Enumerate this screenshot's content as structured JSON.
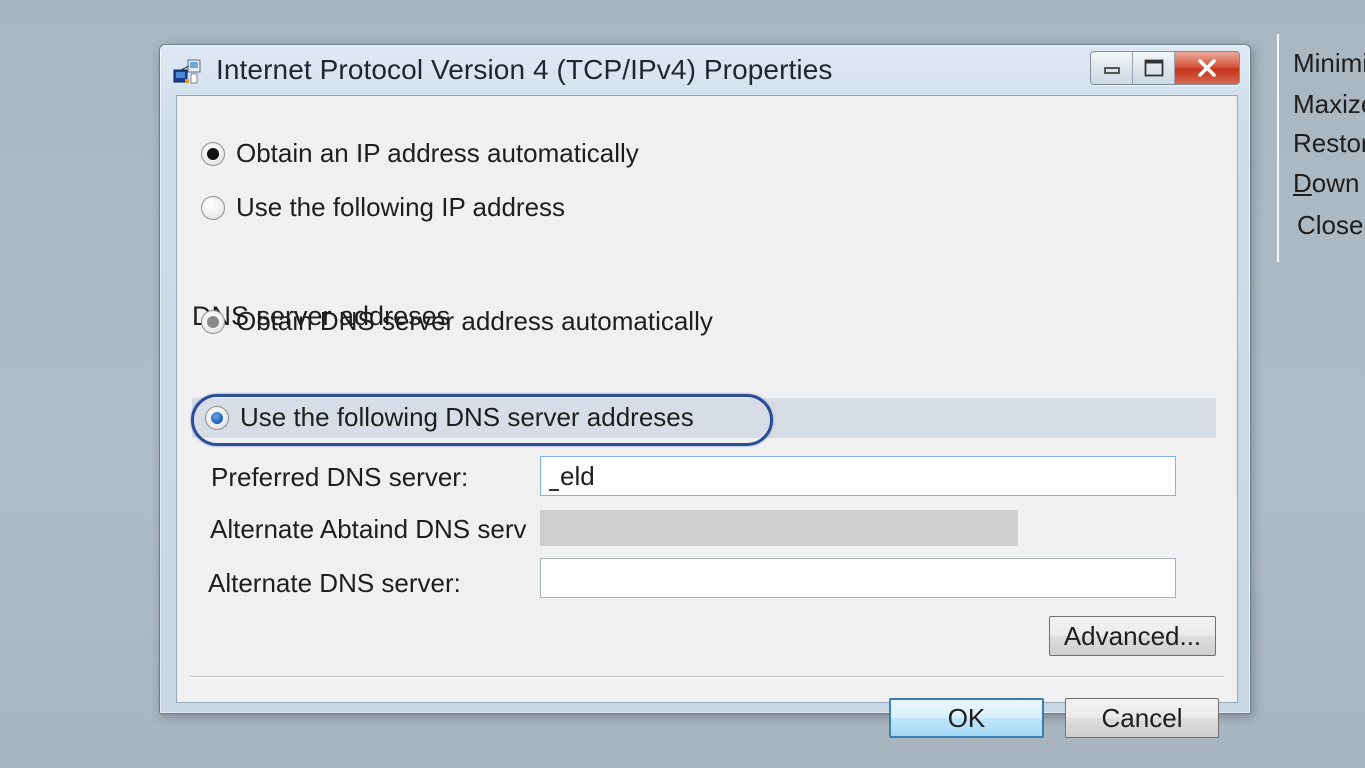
{
  "window": {
    "title": "Internet Protocol Version 4 (TCP/IPv4) Properties",
    "icons": {
      "app": "network-adapter-icon",
      "minimize": "minimize-icon",
      "maximize": "maximize-icon",
      "close": "close-icon"
    }
  },
  "ip": {
    "auto_label": "Obtain an IP address automatically",
    "manual_label": "Use the following IP address",
    "selected": "auto"
  },
  "dns": {
    "section_label": "DNS server addreses",
    "auto_label": "Obtain DNS server address automatically",
    "manual_label": "Use the following DNS server addreses",
    "selected": "manual",
    "preferred_label": "Preferred DNS server:",
    "preferred_value": "eld",
    "alt_obtained_label": "Alternate Abtaind DNS serv",
    "alternate_label": "Alternate DNS server:",
    "alternate_value": ""
  },
  "buttons": {
    "advanced": "Advanced...",
    "ok": "OK",
    "cancel": "Cancel"
  },
  "context_menu": {
    "items": [
      "Minimi",
      "Maxize",
      "Restor",
      "Down",
      "Close"
    ]
  },
  "colors": {
    "highlight_oval": "#2b4c97",
    "close_button": "#c2351c",
    "selected_radio": "#1a5fb4"
  }
}
